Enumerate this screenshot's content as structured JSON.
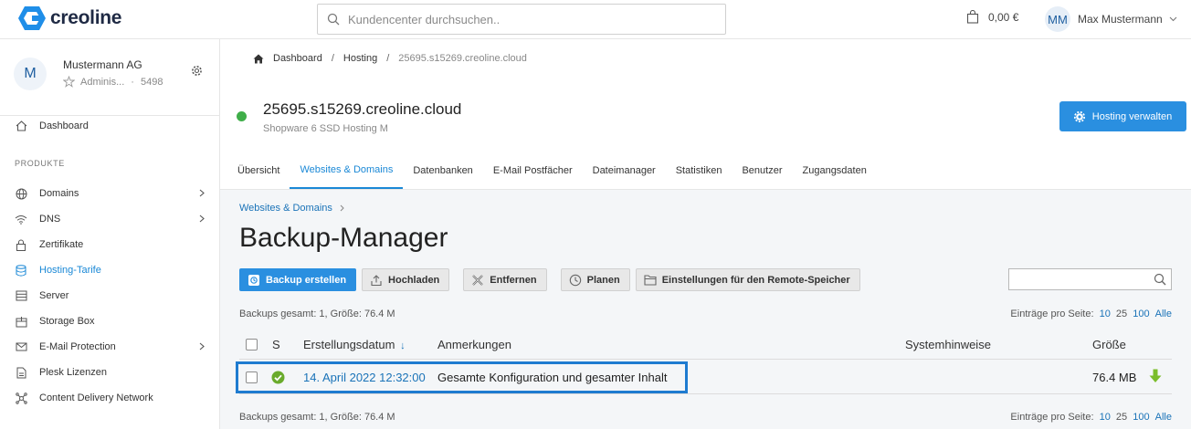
{
  "topbar": {
    "brand": "creoline",
    "search_placeholder": "Kundencenter durchsuchen..",
    "cart_total": "0,00 €",
    "user_initials": "MM",
    "user_name": "Max Mustermann"
  },
  "sidebar": {
    "account_initial": "M",
    "account_name": "Mustermann AG",
    "account_role": "Adminis...",
    "account_meta_sep": "·",
    "account_number": "5498",
    "dashboard_label": "Dashboard",
    "section_label": "PRODUKTE",
    "items": [
      {
        "label": "Domains",
        "icon": "globe-icon",
        "chevron": true
      },
      {
        "label": "DNS",
        "icon": "wifi-icon",
        "chevron": true
      },
      {
        "label": "Zertifikate",
        "icon": "lock-icon",
        "chevron": false
      },
      {
        "label": "Hosting-Tarife",
        "icon": "database-icon",
        "chevron": false,
        "active": true
      },
      {
        "label": "Server",
        "icon": "server-icon",
        "chevron": false
      },
      {
        "label": "Storage Box",
        "icon": "box-icon",
        "chevron": false
      },
      {
        "label": "E-Mail Protection",
        "icon": "mail-icon",
        "chevron": true
      },
      {
        "label": "Plesk Lizenzen",
        "icon": "document-icon",
        "chevron": false
      },
      {
        "label": "Content Delivery Network",
        "icon": "network-icon",
        "chevron": false
      }
    ]
  },
  "breadcrumb": {
    "sep": "/",
    "items": [
      "Dashboard",
      "Hosting",
      "25695.s15269.creoline.cloud"
    ]
  },
  "header": {
    "title": "25695.s15269.creoline.cloud",
    "subtitle": "Shopware 6 SSD Hosting M",
    "manage_button": "Hosting verwalten",
    "status_color": "#3fae49"
  },
  "tabs": [
    "Übersicht",
    "Websites & Domains",
    "Datenbanken",
    "E-Mail Postfächer",
    "Dateimanager",
    "Statistiken",
    "Benutzer",
    "Zugangsdaten"
  ],
  "active_tab": 1,
  "backup": {
    "breadcrumb": "Websites & Domains",
    "title": "Backup-Manager",
    "toolbar": {
      "create": "Backup erstellen",
      "upload": "Hochladen",
      "remove": "Entfernen",
      "schedule": "Planen",
      "remote": "Einstellungen für den Remote-Speicher"
    },
    "summary": "Backups gesamt: 1, Größe: 76.4 M",
    "per_page_label": "Einträge pro Seite:",
    "per_page_options": [
      "10",
      "25",
      "100",
      "Alle"
    ],
    "columns": {
      "status": "S",
      "date": "Erstellungsdatum",
      "sort_indicator": "↓",
      "notes": "Anmerkungen",
      "system": "Systemhinweise",
      "size": "Größe"
    },
    "rows": [
      {
        "date": "14. April 2022 12:32:00",
        "notes": "Gesamte Konfiguration und gesamter Inhalt",
        "system": "",
        "size": "76.4 MB",
        "status": "ok"
      }
    ]
  },
  "colors": {
    "accent": "#1a88d6",
    "primary_button": "#2a8fe0",
    "ok_green": "#6aab2c",
    "highlight": "#1e7bd0"
  }
}
